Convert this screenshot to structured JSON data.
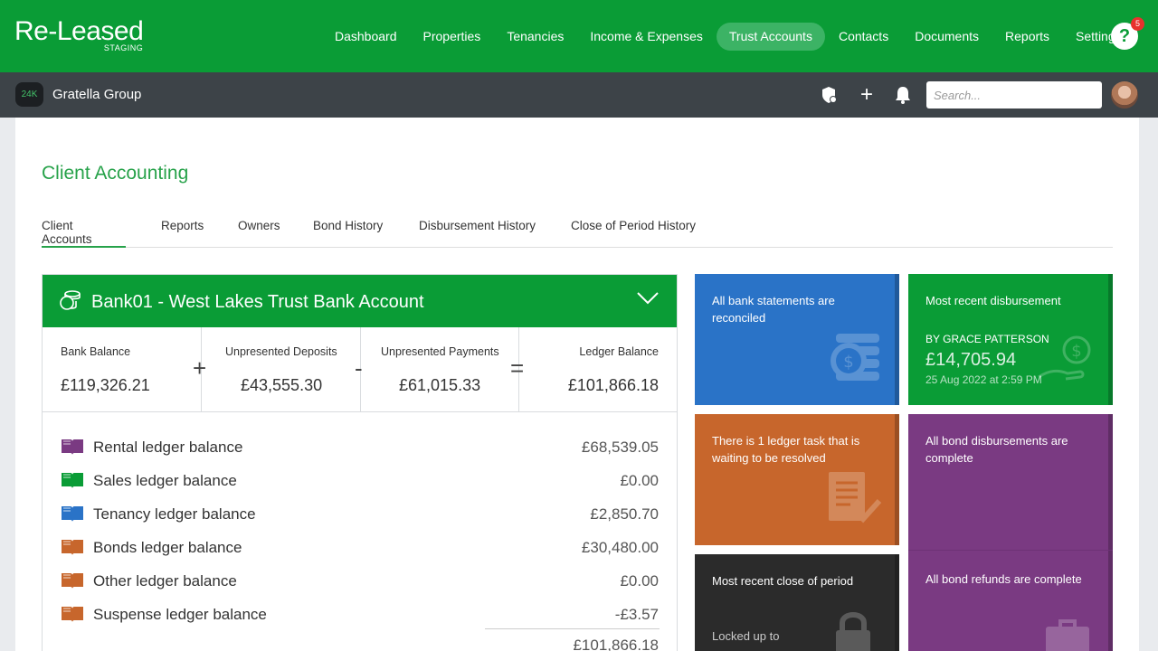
{
  "app": {
    "logo": "Re-Leased",
    "environment": "STAGING"
  },
  "nav": {
    "items": [
      "Dashboard",
      "Properties",
      "Tenancies",
      "Income & Expenses",
      "Trust Accounts",
      "Contacts",
      "Documents",
      "Reports",
      "Settings"
    ],
    "active": "Trust Accounts",
    "help_label": "?",
    "notification_count": "5"
  },
  "subbar": {
    "org_logo": "24K",
    "org_name": "Gratella Group",
    "search_placeholder": "Search..."
  },
  "page": {
    "title": "Client Accounting",
    "tabs": [
      "Client Accounts",
      "Reports",
      "Owners",
      "Bond History",
      "Disbursement History",
      "Close of Period History"
    ],
    "active_tab": "Client Accounts"
  },
  "bank": {
    "title": "Bank01 - West Lakes Trust Bank Account",
    "summary": {
      "bank_balance_label": "Bank Balance",
      "bank_balance": "£119,326.21",
      "unpresented_deposits_label": "Unpresented Deposits",
      "unpresented_deposits": "£43,555.30",
      "unpresented_payments_label": "Unpresented Payments",
      "unpresented_payments": "£61,015.33",
      "ledger_balance_label": "Ledger Balance",
      "ledger_balance": "£101,866.18",
      "op_plus": "+",
      "op_minus": "-",
      "op_equals": "="
    },
    "ledgers": [
      {
        "label": "Rental ledger balance",
        "value": "£68,539.05",
        "color": "#7a3a82"
      },
      {
        "label": "Sales ledger balance",
        "value": "£0.00",
        "color": "#0a9c36"
      },
      {
        "label": "Tenancy ledger balance",
        "value": "£2,850.70",
        "color": "#2a73c7"
      },
      {
        "label": "Bonds ledger balance",
        "value": "£30,480.00",
        "color": "#c7662c"
      },
      {
        "label": "Other ledger balance",
        "value": "£0.00",
        "color": "#c7662c"
      },
      {
        "label": "Suspense ledger balance",
        "value": "-£3.57",
        "color": "#c7662c"
      }
    ],
    "total": "£101,866.18"
  },
  "tiles": {
    "reconciled": {
      "text": "All bank statements are reconciled",
      "color": "#2a73c7"
    },
    "disbursement": {
      "title": "Most recent disbursement",
      "by": "BY GRACE PATTERSON",
      "amount": "£14,705.94",
      "date": "25 Aug 2022 at 2:59 PM",
      "color": "#0a9c36"
    },
    "ledger_task": {
      "text": "There is 1 ledger task that is waiting to be resolved",
      "color": "#c7662c"
    },
    "bond_disbursements": {
      "text": "All bond disbursements are complete",
      "color": "#7a3a82"
    },
    "close_period": {
      "title": "Most recent close of period",
      "locked": "Locked up to",
      "color": "#2b2b2b"
    },
    "bond_refunds": {
      "text": "All bond refunds are complete",
      "color": "#7a3a82"
    }
  }
}
